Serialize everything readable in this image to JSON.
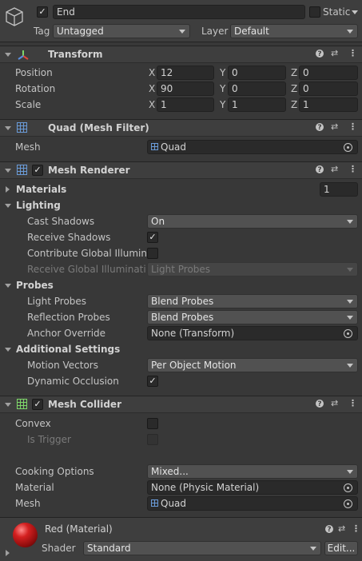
{
  "go": {
    "name": "End",
    "static_label": "Static",
    "tag_label": "Tag",
    "tag_value": "Untagged",
    "layer_label": "Layer",
    "layer_value": "Default"
  },
  "transform": {
    "title": "Transform",
    "position_label": "Position",
    "rotation_label": "Rotation",
    "scale_label": "Scale",
    "x": "X",
    "y": "Y",
    "z": "Z",
    "position": [
      "12",
      "0",
      "0"
    ],
    "rotation": [
      "90",
      "0",
      "0"
    ],
    "scale": [
      "1",
      "1",
      "1"
    ]
  },
  "mesh_filter": {
    "title": "Quad (Mesh Filter)",
    "mesh_label": "Mesh",
    "mesh_value": "Quad"
  },
  "renderer": {
    "title": "Mesh Renderer",
    "materials_label": "Materials",
    "materials_count": "1",
    "lighting_label": "Lighting",
    "cast_shadows_label": "Cast Shadows",
    "cast_shadows_value": "On",
    "receive_shadows_label": "Receive Shadows",
    "contribute_gi_label": "Contribute Global Illuminat",
    "receive_gi_label": "Receive Global Illumination",
    "receive_gi_value": "Light Probes",
    "probes_label": "Probes",
    "light_probes_label": "Light Probes",
    "light_probes_value": "Blend Probes",
    "reflection_probes_label": "Reflection Probes",
    "reflection_probes_value": "Blend Probes",
    "anchor_label": "Anchor Override",
    "anchor_value": "None (Transform)",
    "additional_label": "Additional Settings",
    "motion_label": "Motion Vectors",
    "motion_value": "Per Object Motion",
    "dynamic_occlusion_label": "Dynamic Occlusion"
  },
  "collider": {
    "title": "Mesh Collider",
    "convex_label": "Convex",
    "trigger_label": "Is Trigger",
    "cooking_label": "Cooking Options",
    "cooking_value": "Mixed...",
    "material_label": "Material",
    "material_value": "None (Physic Material)",
    "mesh_label": "Mesh",
    "mesh_value": "Quad"
  },
  "material": {
    "name": "Red (Material)",
    "shader_label": "Shader",
    "shader_value": "Standard",
    "edit_label": "Edit..."
  },
  "icons": {
    "help": "?",
    "presets": "⇄",
    "more": "⋮",
    "check": "✓"
  },
  "colors": {
    "accent_red": "#c81c1c",
    "grid_blue": "#6a9bd8",
    "grid_green": "#7ed86a"
  }
}
